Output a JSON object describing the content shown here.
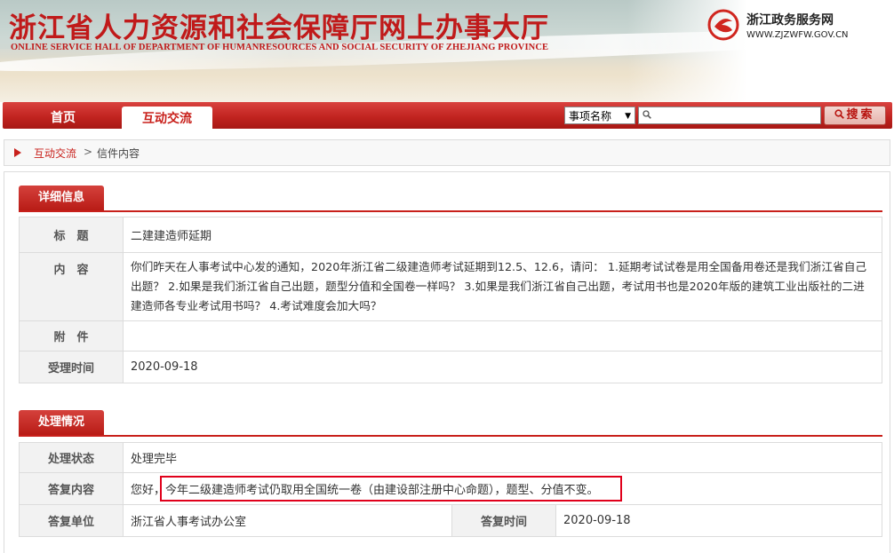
{
  "header": {
    "title": "浙江省人力资源和社会保障厅网上办事大厅",
    "subtitle": "ONLINE SERVICE HALL OF DEPARTMENT OF HUMANRESOURCES AND SOCIAL SECURITY OF ZHEJIANG PROVINCE",
    "portal_name": "浙江政务服务网",
    "portal_url": "WWW.ZJZWFW.GOV.CN"
  },
  "nav": {
    "home": "首页",
    "active_tab": "互动交流",
    "select_value": "事项名称",
    "search_placeholder": "",
    "search_button": "搜索"
  },
  "breadcrumb": {
    "parent": "互动交流",
    "separator": ">",
    "current": "信件内容"
  },
  "detail": {
    "heading": "详细信息",
    "rows": [
      {
        "label": "标　题",
        "value": "二建建造师延期"
      },
      {
        "label": "内　容",
        "value": "你们昨天在人事考试中心发的通知，2020年浙江省二级建造师考试延期到12.5、12.6，请问： 1.延期考试试卷是用全国备用卷还是我们浙江省自己出题？ 2.如果是我们浙江省自己出题，题型分值和全国卷一样吗？ 3.如果是我们浙江省自己出题，考试用书也是2020年版的建筑工业出版社的二进建造师各专业考试用书吗？ 4.考试难度会加大吗？"
      },
      {
        "label": "附　件",
        "value": ""
      },
      {
        "label": "受理时间",
        "value": "2020-09-18"
      }
    ]
  },
  "handling": {
    "heading": "处理情况",
    "status_label": "处理状态",
    "status_value": "处理完毕",
    "reply_label": "答复内容",
    "reply_prefix": "您好，",
    "reply_highlight": "今年二级建造师考试仍取用全国统一卷（由建设部注册中心命题），题型、分值不变。",
    "unit_label": "答复单位",
    "unit_value": "浙江省人事考试办公室",
    "time_label": "答复时间",
    "time_value": "2020-09-18"
  },
  "colors": {
    "brand_red": "#c8201b",
    "highlight_box": "#e0001b"
  }
}
